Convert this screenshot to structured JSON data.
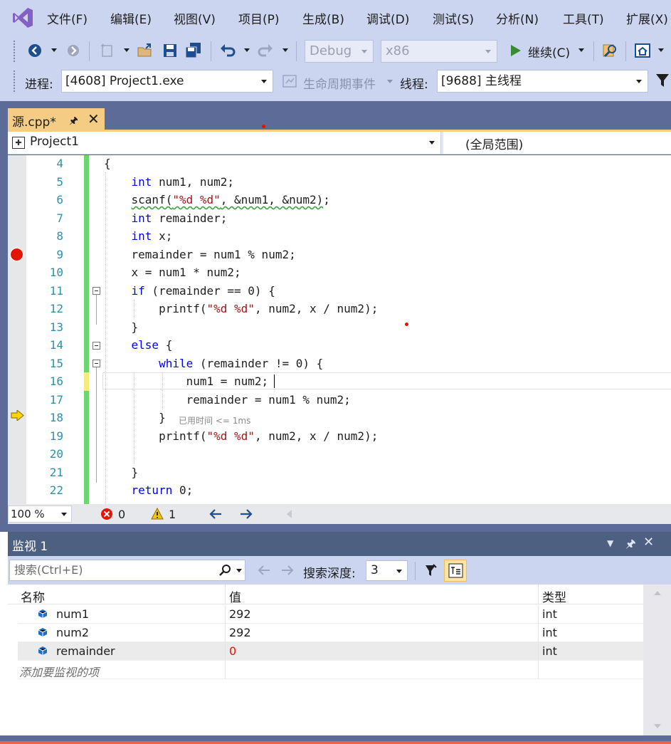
{
  "menu": [
    "文件(F)",
    "编辑(E)",
    "视图(V)",
    "项目(P)",
    "生成(B)",
    "调试(D)",
    "测试(S)",
    "分析(N)",
    "工具(T)",
    "扩展(X)"
  ],
  "toolbar": {
    "config": "Debug",
    "platform": "x86",
    "continue_label": "继续(C)"
  },
  "debug_location": {
    "process_label": "进程:",
    "process_value": "[4608] Project1.exe",
    "lifecycle_label": "生命周期事件",
    "thread_label": "线程:",
    "thread_value": "[9688] 主线程"
  },
  "document_tab": {
    "title": "源.cpp*"
  },
  "navbar": {
    "project": "Project1",
    "scope": "(全局范围)"
  },
  "editor": {
    "line_numbers": [
      "4",
      "5",
      "6",
      "7",
      "8",
      "9",
      "10",
      "11",
      "12",
      "13",
      "14",
      "15",
      "16",
      "17",
      "18",
      "19",
      "20",
      "21",
      "22"
    ],
    "breakpoint_line": "9",
    "current_statement_line": "18",
    "elapsed_hint": "已用时间 <= 1ms"
  },
  "editor_status": {
    "zoom": "100 %",
    "errors": "0",
    "warnings": "1"
  },
  "watch": {
    "title": "监视 1",
    "search_placeholder": "搜索(Ctrl+E)",
    "depth_label": "搜索深度:",
    "depth_value": "3",
    "columns": [
      "名称",
      "值",
      "类型"
    ],
    "rows": [
      {
        "name": "num1",
        "value": "292",
        "type": "int"
      },
      {
        "name": "num2",
        "value": "292",
        "type": "int"
      },
      {
        "name": "remainder",
        "value": "0",
        "type": "int"
      }
    ],
    "add_placeholder": "添加要监视的项"
  },
  "colors": {
    "accent_tab": "#f5cc84",
    "chrome": "#ccd5f0",
    "well": "#5d6b99",
    "breakpoint": "#e51400",
    "keyword": "#0000ff",
    "string": "#a31515",
    "line_number": "#2b91af"
  }
}
